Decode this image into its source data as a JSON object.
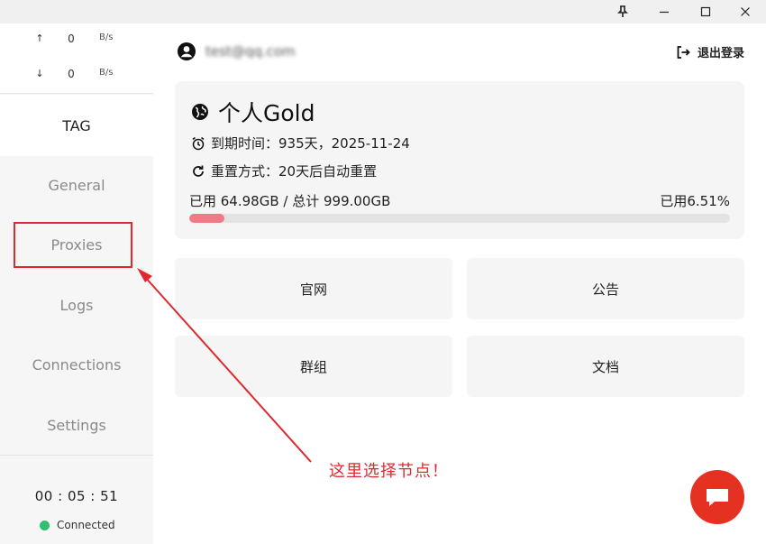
{
  "sidebar": {
    "upload": {
      "arrow": "↑",
      "value": "0",
      "unit": "B/s"
    },
    "download": {
      "arrow": "↓",
      "value": "0",
      "unit": "B/s"
    },
    "tag": "TAG",
    "nav": [
      {
        "label": "General"
      },
      {
        "label": "Proxies"
      },
      {
        "label": "Logs"
      },
      {
        "label": "Connections"
      },
      {
        "label": "Settings"
      }
    ],
    "timer": "00 : 05 : 51",
    "status": "Connected",
    "status_color": "#2fbf71"
  },
  "account": {
    "email": "test@qq.com",
    "logout_label": "退出登录"
  },
  "plan": {
    "name": "个人Gold",
    "expiry": "到期时间：935天，2025-11-24",
    "reset": "重置方式：20天后自动重置",
    "usage": "已用 64.98GB  /  总计 999.00GB",
    "percent_label": "已用6.51%",
    "used_fraction": 0.0651
  },
  "tiles": [
    "官网",
    "公告",
    "群组",
    "文档"
  ],
  "annotation": {
    "note": "这里选择节点！",
    "color": "#e0282e"
  },
  "colors": {
    "accent": "#e53122",
    "progress": "#f07a86"
  },
  "icons": [
    "pin-icon",
    "minimize-icon",
    "maximize-icon",
    "close-icon",
    "user-icon",
    "logout-icon",
    "globe-icon",
    "alarm-clock-icon",
    "refresh-icon",
    "chat-icon"
  ]
}
